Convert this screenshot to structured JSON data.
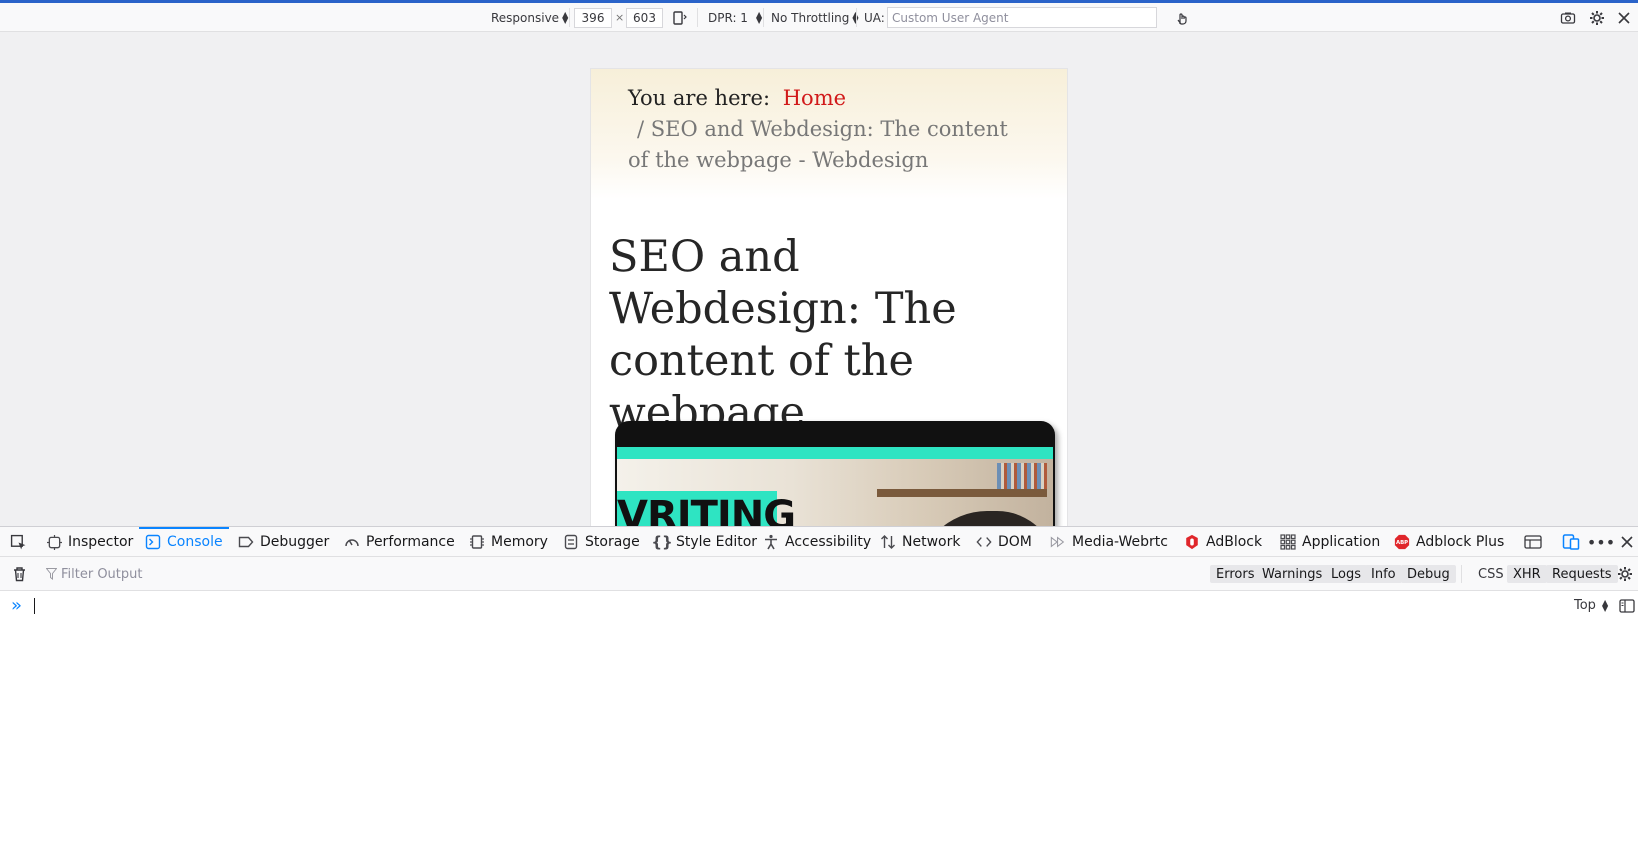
{
  "rdm_toolbar": {
    "device_label": "Responsive",
    "width_value": "396",
    "times": "×",
    "height_value": "603",
    "dpr_label": "DPR: 1",
    "throttle_label": "No Throttling",
    "ua_label": "UA:",
    "ua_placeholder": "Custom User Agent"
  },
  "page": {
    "breadcrumb_prefix": "You are here:",
    "breadcrumb_home": "Home",
    "breadcrumb_separator": "/",
    "breadcrumb_current": "SEO and Webdesign: The content of the webpage - Webdesign",
    "heading": "SEO and Webdesign: The content of the webpage",
    "hero_text": "VRITING"
  },
  "devtools": {
    "tabs": [
      {
        "label": "Inspector",
        "icon": "inspector-icon"
      },
      {
        "label": "Console",
        "icon": "console-icon"
      },
      {
        "label": "Debugger",
        "icon": "debugger-icon"
      },
      {
        "label": "Performance",
        "icon": "performance-icon"
      },
      {
        "label": "Memory",
        "icon": "memory-icon"
      },
      {
        "label": "Storage",
        "icon": "storage-icon"
      },
      {
        "label": "Style Editor",
        "icon": "style-editor-icon"
      },
      {
        "label": "Accessibility",
        "icon": "accessibility-icon"
      },
      {
        "label": "Network",
        "icon": "network-icon"
      },
      {
        "label": "DOM",
        "icon": "dom-icon"
      },
      {
        "label": "Media-Webrtc",
        "icon": "media-webrtc-icon"
      },
      {
        "label": "AdBlock",
        "icon": "adblock-icon"
      },
      {
        "label": "Application",
        "icon": "application-icon"
      },
      {
        "label": "Adblock Plus",
        "icon": "adblock-plus-icon"
      }
    ],
    "selected_tab": "Console",
    "filter_placeholder": "Filter Output",
    "filters": [
      "Errors",
      "Warnings",
      "Logs",
      "Info",
      "Debug"
    ],
    "extra_filters": [
      "CSS",
      "XHR",
      "Requests"
    ],
    "context_label": "Top"
  },
  "colors": {
    "accent": "#0a84ff",
    "home_link": "#d11a1a",
    "hero_teal": "#2ee4c2"
  }
}
